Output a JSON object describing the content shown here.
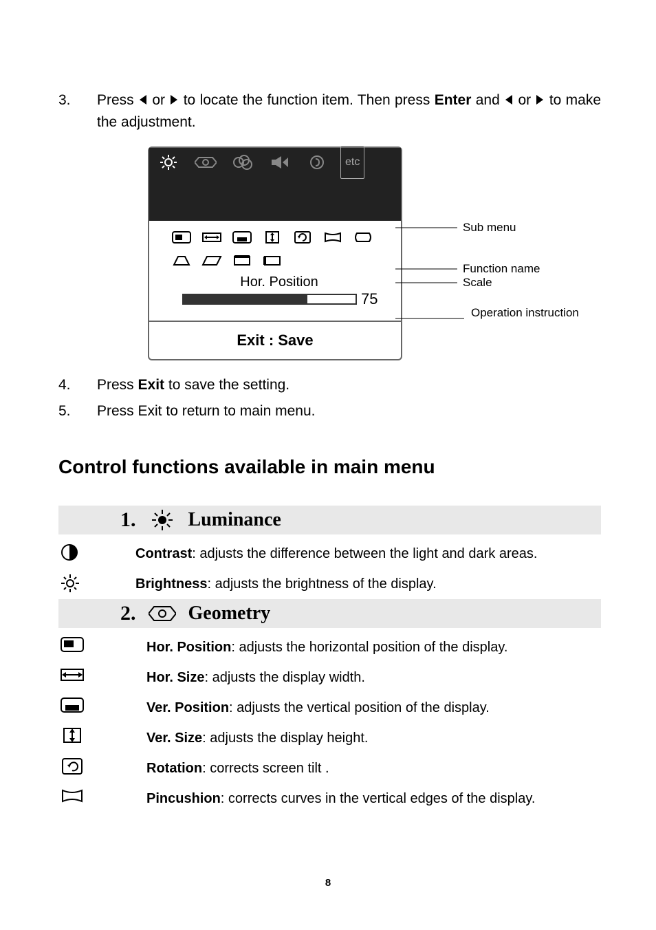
{
  "steps": {
    "s3": {
      "num": "3.",
      "pre": "Press ",
      "mid1": " or ",
      "mid2": "  to locate the function item.  Then press ",
      "enter": "Enter",
      "mid3": " and ",
      "mid4": " or ",
      "post": "  to make the adjustment."
    },
    "s4": {
      "num": "4.",
      "pre": "Press ",
      "exit": "Exit",
      "post": " to save the setting."
    },
    "s5": {
      "num": "5.",
      "text": "Press Exit to return to main menu."
    }
  },
  "osd": {
    "etc": "etc",
    "function_name": "Hor. Position",
    "scale_value": "75",
    "footer": "Exit : Save",
    "annotations": {
      "sub_menu": "Sub menu",
      "function_name": "Function name",
      "scale": "Scale",
      "operation": "Operation instruction"
    }
  },
  "heading": "Control functions available in main menu",
  "sections": {
    "luminance": {
      "num": "1.",
      "title": "Luminance",
      "items": [
        {
          "name": "Contrast",
          "desc": ": adjusts the difference between the light and dark areas."
        },
        {
          "name": "Brightness",
          "desc": ": adjusts the brightness of the display."
        }
      ]
    },
    "geometry": {
      "num": "2.",
      "title": "Geometry",
      "items": [
        {
          "name": "Hor. Position",
          "desc": ": adjusts the horizontal position of the display."
        },
        {
          "name": "Hor. Size",
          "desc": ": adjusts the display width."
        },
        {
          "name": "Ver. Position",
          "desc": ": adjusts the vertical position of the display."
        },
        {
          "name": "Ver. Size",
          "desc": ": adjusts the display height."
        },
        {
          "name": "Rotation",
          "desc": ": corrects screen tilt ."
        },
        {
          "name": "Pincushion",
          "desc": ": corrects curves in the vertical edges of the display."
        }
      ]
    }
  },
  "page_number": "8"
}
